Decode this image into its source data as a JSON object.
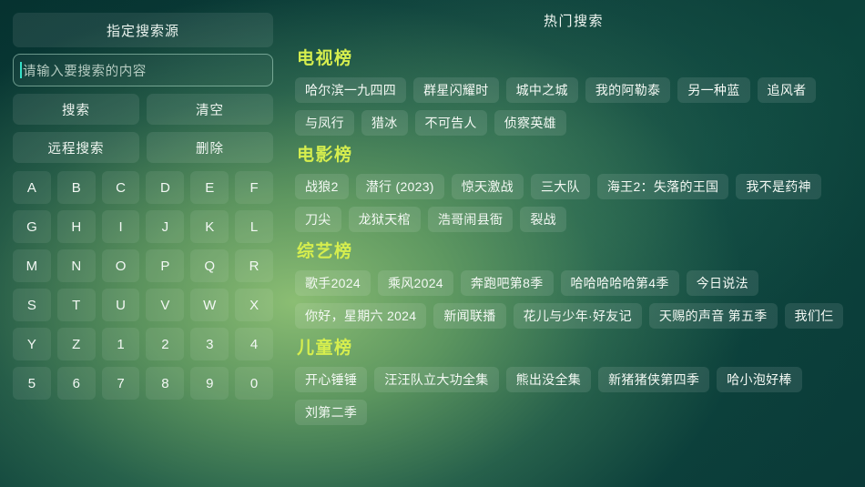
{
  "left_panel": {
    "source_header": "指定搜索源",
    "search_input": {
      "value": "",
      "placeholder": "请输入要搜索的内容"
    },
    "buttons": [
      {
        "label": "搜索"
      },
      {
        "label": "清空"
      },
      {
        "label": "远程搜索"
      },
      {
        "label": "删除"
      }
    ],
    "keyboard": [
      "A",
      "B",
      "C",
      "D",
      "E",
      "F",
      "G",
      "H",
      "I",
      "J",
      "K",
      "L",
      "M",
      "N",
      "O",
      "P",
      "Q",
      "R",
      "S",
      "T",
      "U",
      "V",
      "W",
      "X",
      "Y",
      "Z",
      "1",
      "2",
      "3",
      "4",
      "5",
      "6",
      "7",
      "8",
      "9",
      "0"
    ]
  },
  "right_panel": {
    "title": "热门搜索",
    "sections": [
      {
        "title": "电视榜",
        "items": [
          "哈尔滨一九四四",
          "群星闪耀时",
          "城中之城",
          "我的阿勒泰",
          "另一种蓝",
          "追风者",
          "与凤行",
          "猎冰",
          "不可告人",
          "侦察英雄"
        ]
      },
      {
        "title": "电影榜",
        "items": [
          "战狼2",
          "潜行 (2023)",
          "惊天激战",
          "三大队",
          "海王2：失落的王国",
          "我不是药神",
          "刀尖",
          "龙狱天棺",
          "浩哥闹县衙",
          "裂战"
        ]
      },
      {
        "title": "综艺榜",
        "items": [
          "歌手2024",
          "乘风2024",
          "奔跑吧第8季",
          "哈哈哈哈哈第4季",
          "今日说法",
          "你好，星期六 2024",
          "新闻联播",
          "花儿与少年·好友记",
          "天赐的声音 第五季",
          "我们仨"
        ]
      },
      {
        "title": "儿童榜",
        "items": [
          "开心锤锤",
          "汪汪队立大功全集",
          "熊出没全集",
          "新猪猪侠第四季",
          "哈小泡好棒",
          "刘第二季"
        ]
      }
    ]
  },
  "colors": {
    "section_title": "#d6ee4e",
    "caret": "#37e0c8",
    "chip_text": "#f4f9f4"
  }
}
